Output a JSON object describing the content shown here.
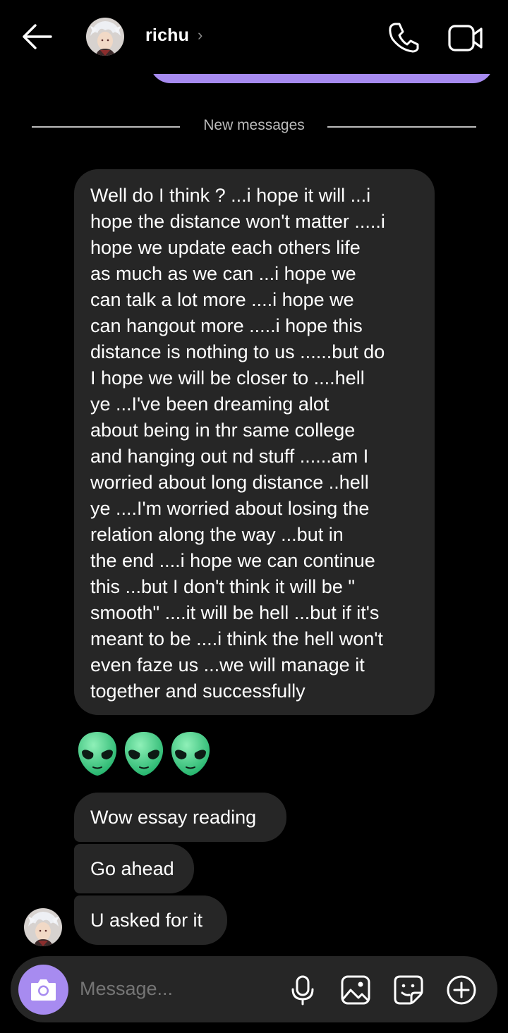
{
  "header": {
    "contact_name": "richu",
    "chevron": "›",
    "icons": {
      "back": "arrow-left-icon",
      "call": "phone-icon",
      "video": "video-camera-icon"
    }
  },
  "divider": {
    "label": "New messages"
  },
  "messages": {
    "long": "Well do I think ? ...i hope it will ...i\nhope the distance won't matter .....i\nhope we update each others life\nas much as we can ...i hope we\ncan talk a lot more ....i hope we\ncan hangout more .....i hope this\ndistance is nothing to us ......but do\nI hope we will be closer to ....hell\nye ...I've been dreaming alot\nabout being in thr same college\nand hanging out nd stuff ......am I\nworried about long distance ..hell\nye ....I'm worried about losing the\nrelation along the way ...but in\nthe end ....i hope we can continue\nthis ...but I don't think it will be \"\nsmooth\" ....it will be hell ...but if it's\nmeant to be ....i think the hell won't\neven faze us ...we will manage it\ntogether and successfully",
    "emoji": [
      "alien-emoji",
      "alien-emoji",
      "alien-emoji"
    ],
    "short": [
      "Wow essay reading",
      "Go ahead",
      "U asked for it"
    ]
  },
  "composer": {
    "placeholder": "Message...",
    "icons": [
      "camera-icon",
      "microphone-icon",
      "gallery-icon",
      "sticker-icon",
      "plus-icon"
    ]
  },
  "colors": {
    "accent": "#a78bf0",
    "bubble": "#262626",
    "background": "#000000",
    "muted": "#9a9a9a"
  }
}
